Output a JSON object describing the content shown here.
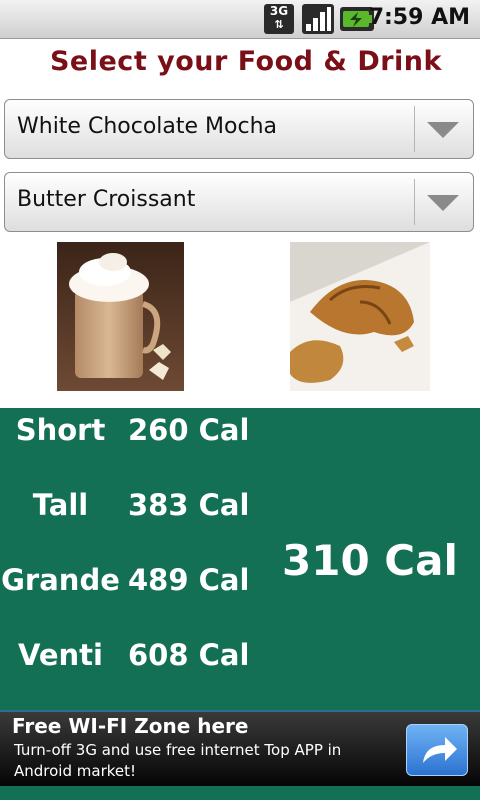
{
  "status_bar": {
    "network_label": "3G",
    "time": "7:59 AM",
    "signal_icon": "signal-bars-icon",
    "battery_icon": "battery-charging-icon"
  },
  "title": "Select your Food & Drink",
  "spinners": {
    "drink": {
      "selected": "White Chocolate Mocha"
    },
    "food": {
      "selected": "Butter Croissant"
    }
  },
  "images": {
    "drink": "mocha-photo",
    "food": "croissant-photo"
  },
  "calories": {
    "sizes": [
      {
        "name": "Short",
        "cal": "260 Cal"
      },
      {
        "name": "Tall",
        "cal": "383 Cal"
      },
      {
        "name": "Grande",
        "cal": "489 Cal"
      },
      {
        "name": "Venti",
        "cal": "608 Cal"
      }
    ],
    "food_total": "310 Cal"
  },
  "ad": {
    "title": "Free WI-FI Zone here",
    "body": "Turn-off 3G and use free internet Top APP in Android market!",
    "button_icon": "share-arrow-icon"
  },
  "colors": {
    "title": "#7a0f17",
    "panel": "#137054"
  }
}
